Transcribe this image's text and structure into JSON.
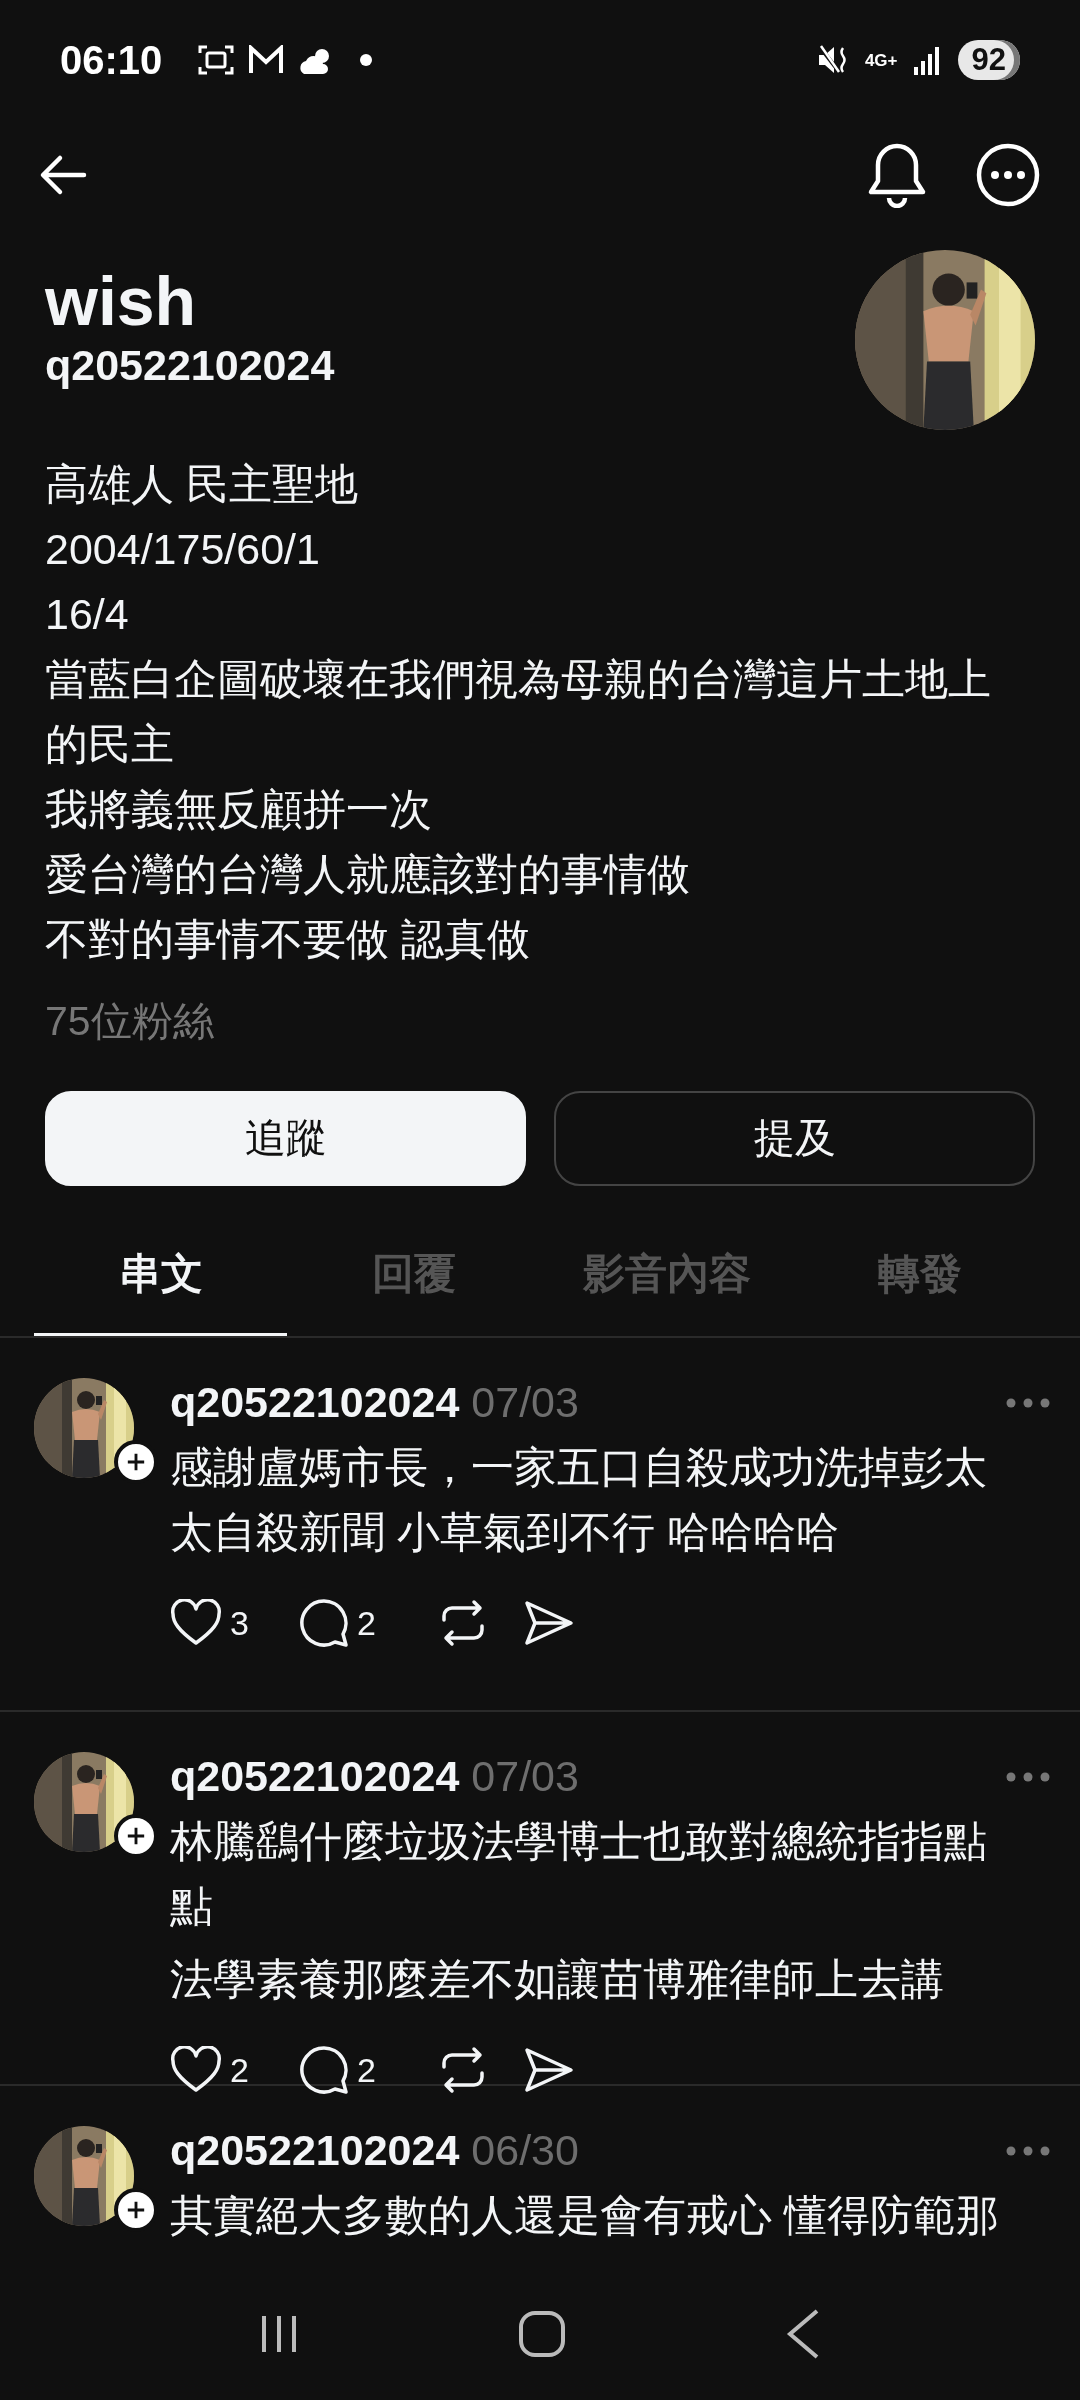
{
  "status_bar": {
    "time": "06:10",
    "network": "4G+",
    "battery": "92"
  },
  "profile": {
    "name": "wish",
    "username": "q20522102024",
    "bio": [
      "高雄人 民主聖地",
      "2004/175/60/1",
      "16/4",
      "當藍白企圖破壞在我們視為母親的台灣這片土地上的民主",
      "我將義無反顧拼一次",
      "愛台灣的台灣人就應該對的事情做",
      "不對的事情不要做 認真做"
    ],
    "followers": "75位粉絲"
  },
  "actions": [
    {
      "label": "追蹤",
      "kind": "primary"
    },
    {
      "label": "提及",
      "kind": "outline"
    }
  ],
  "tabs": [
    {
      "label": "串文",
      "selected": true
    },
    {
      "label": "回覆",
      "selected": false
    },
    {
      "label": "影音內容",
      "selected": false
    },
    {
      "label": "轉發",
      "selected": false
    }
  ],
  "posts": [
    {
      "username": "q20522102024",
      "date": "07/03",
      "text": [
        "感謝盧媽市長，一家五口自殺成功洗掉彭太太自殺新聞 小草氣到不行 哈哈哈哈"
      ],
      "likes": "3",
      "comments": "2"
    },
    {
      "username": "q20522102024",
      "date": "07/03",
      "text": [
        "林騰鷂什麼垃圾法學博士也敢對總統指指點點",
        "法學素養那麼差不如讓苗博雅律師上去講"
      ],
      "likes": "2",
      "comments": "2"
    },
    {
      "username": "q20522102024",
      "date": "06/30",
      "text": [
        "其實絕大多數的人還是會有戒心 懂得防範那"
      ]
    }
  ]
}
